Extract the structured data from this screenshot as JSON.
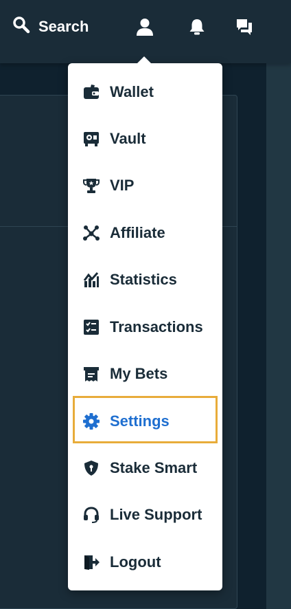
{
  "topbar": {
    "search_label": "Search",
    "icons": [
      "search-icon",
      "user-icon",
      "bell-icon",
      "chat-icon"
    ]
  },
  "menu": {
    "items": [
      {
        "label": "Wallet",
        "icon": "wallet-icon"
      },
      {
        "label": "Vault",
        "icon": "vault-icon"
      },
      {
        "label": "VIP",
        "icon": "trophy-icon"
      },
      {
        "label": "Affiliate",
        "icon": "affiliate-icon"
      },
      {
        "label": "Statistics",
        "icon": "statistics-icon"
      },
      {
        "label": "Transactions",
        "icon": "transactions-icon"
      },
      {
        "label": "My Bets",
        "icon": "bets-icon"
      },
      {
        "label": "Settings",
        "icon": "gear-icon",
        "active": true
      },
      {
        "label": "Stake Smart",
        "icon": "shield-icon"
      },
      {
        "label": "Live Support",
        "icon": "headset-icon"
      },
      {
        "label": "Logout",
        "icon": "logout-icon"
      }
    ]
  },
  "colors": {
    "background": "#1a2c38",
    "menu_text": "#1a2c38",
    "active_text": "#1f6fd0",
    "highlight_border": "#e8ac3a"
  }
}
